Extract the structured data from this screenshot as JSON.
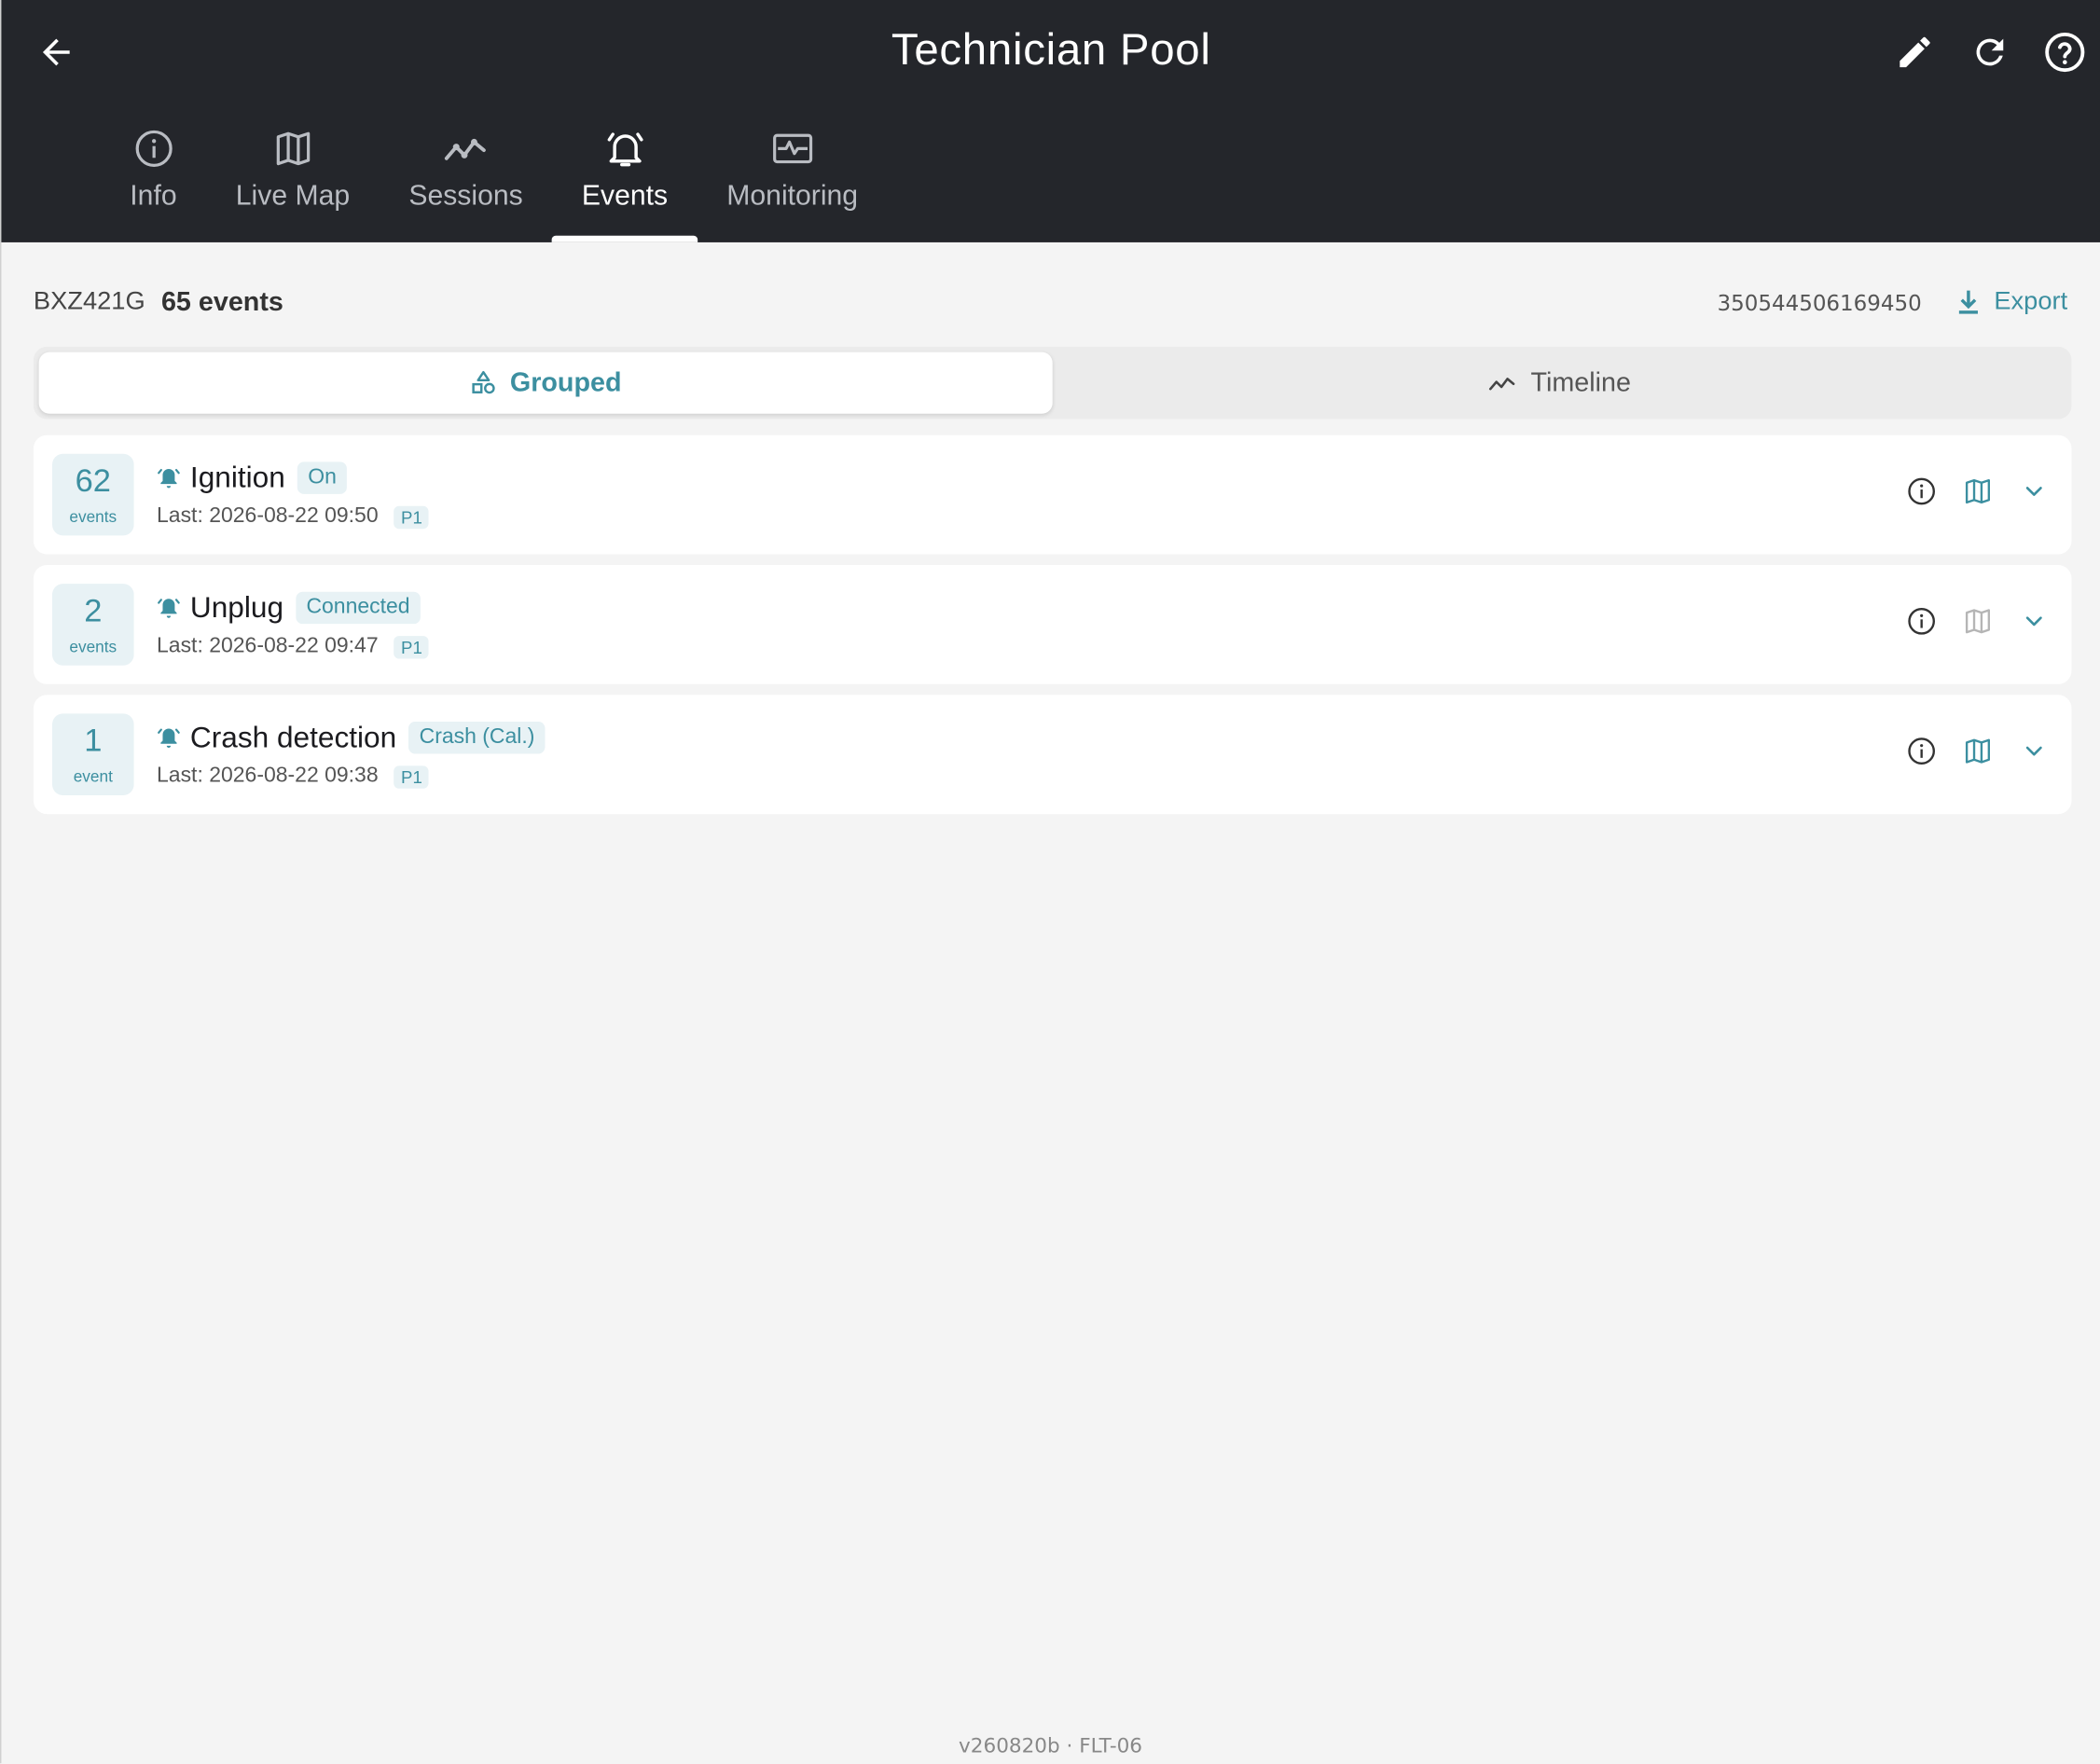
{
  "header": {
    "title": "Technician Pool",
    "back_icon": "arrow-left-icon",
    "actions": [
      "edit-icon",
      "refresh-icon",
      "help-icon"
    ]
  },
  "tabs": [
    {
      "label": "Info",
      "icon": "info-icon",
      "active": false
    },
    {
      "label": "Live Map",
      "icon": "map-icon",
      "active": false
    },
    {
      "label": "Sessions",
      "icon": "trend-icon",
      "active": false
    },
    {
      "label": "Events",
      "icon": "bell-icon",
      "active": true
    },
    {
      "label": "Monitoring",
      "icon": "monitor-icon",
      "active": false
    }
  ],
  "subhead": {
    "vehicle_id": "BXZ421G",
    "events_total": "65 events",
    "device_serial": "350544506169450",
    "export_label": "Export"
  },
  "view_toggle": {
    "grouped": "Grouped",
    "timeline": "Timeline",
    "selected": "Grouped"
  },
  "groups": [
    {
      "count": "62",
      "unit": "events",
      "name": "Ignition",
      "state": "On",
      "last": "Last: 2026-08-22 09:50",
      "priority": "P1",
      "map_enabled": true
    },
    {
      "count": "2",
      "unit": "events",
      "name": "Unplug",
      "state": "Connected",
      "last": "Last: 2026-08-22 09:47",
      "priority": "P1",
      "map_enabled": false
    },
    {
      "count": "1",
      "unit": "event",
      "name": "Crash detection",
      "state": "Crash (Cal.)",
      "last": "Last: 2026-08-22 09:38",
      "priority": "P1",
      "map_enabled": true
    }
  ],
  "footer": "v260820b · FLT-06",
  "colors": {
    "accent": "#3c8fa0",
    "header_bg": "#24262b",
    "page_bg": "#f4f4f4",
    "chip_bg": "#e8f2f5"
  }
}
